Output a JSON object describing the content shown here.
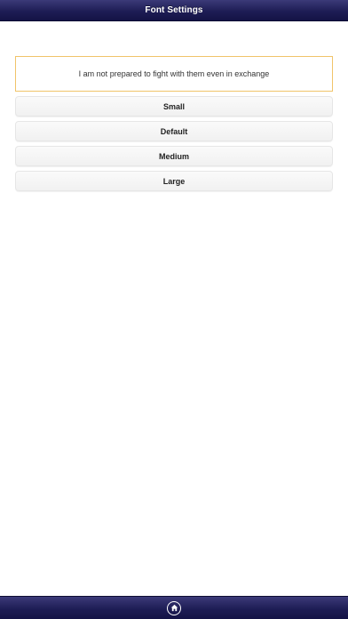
{
  "header": {
    "title": "Font Settings"
  },
  "preview": {
    "text": "I am not prepared to fight with them even in exchange"
  },
  "font_sizes": {
    "small": "Small",
    "default": "Default",
    "medium": "Medium",
    "large": "Large"
  },
  "footer": {
    "home_icon": "home-icon"
  },
  "colors": {
    "bar": "#1e1d55",
    "preview_border": "#f0c46a",
    "button_bg": "#f4f4f4"
  }
}
